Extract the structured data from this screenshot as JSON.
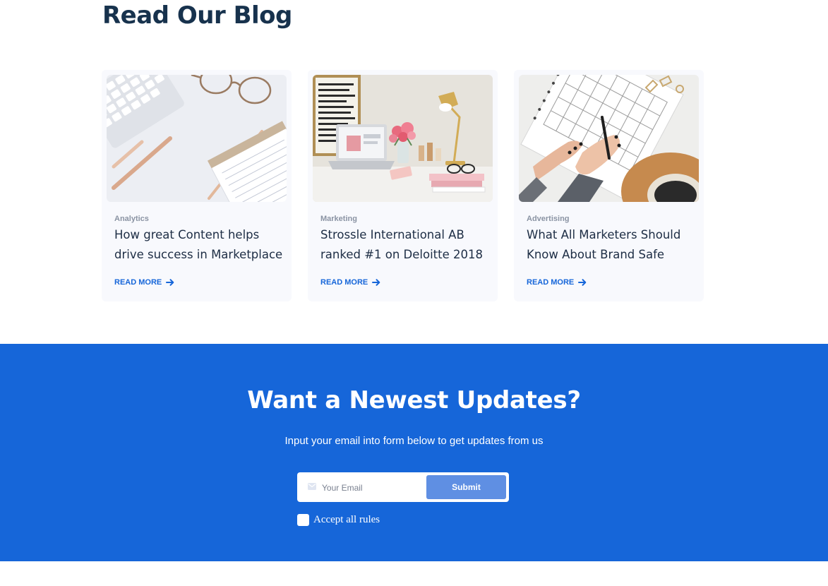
{
  "blog": {
    "heading": "Read Our Blog",
    "cards": [
      {
        "category": "Analytics",
        "title": "How great Content helps drive success in Marketplace",
        "read_more": "READ MORE",
        "image": "desk-keyboard-glasses-photo"
      },
      {
        "category": "Marketing",
        "title": "Strossle International AB ranked #1 on Deloitte 2018",
        "read_more": "READ MORE",
        "image": "laptop-lamp-flowers-photo"
      },
      {
        "category": "Advertising",
        "title": "What All Marketers Should Know About Brand Safe",
        "read_more": "READ MORE",
        "image": "hands-writing-planner-photo"
      }
    ]
  },
  "newsletter": {
    "title": "Want a Newest Updates?",
    "subtitle": "Input your email into form below to get updates from us",
    "email_placeholder": "Your Email",
    "email_value": "",
    "submit_label": "Submit",
    "accept_label": "Accept all rules",
    "accept_checked": false
  },
  "colors": {
    "brand_blue": "#1666d9",
    "heading": "#17324d",
    "card_bg": "#f8f9fd",
    "submit_bg": "#5f8fe3"
  }
}
